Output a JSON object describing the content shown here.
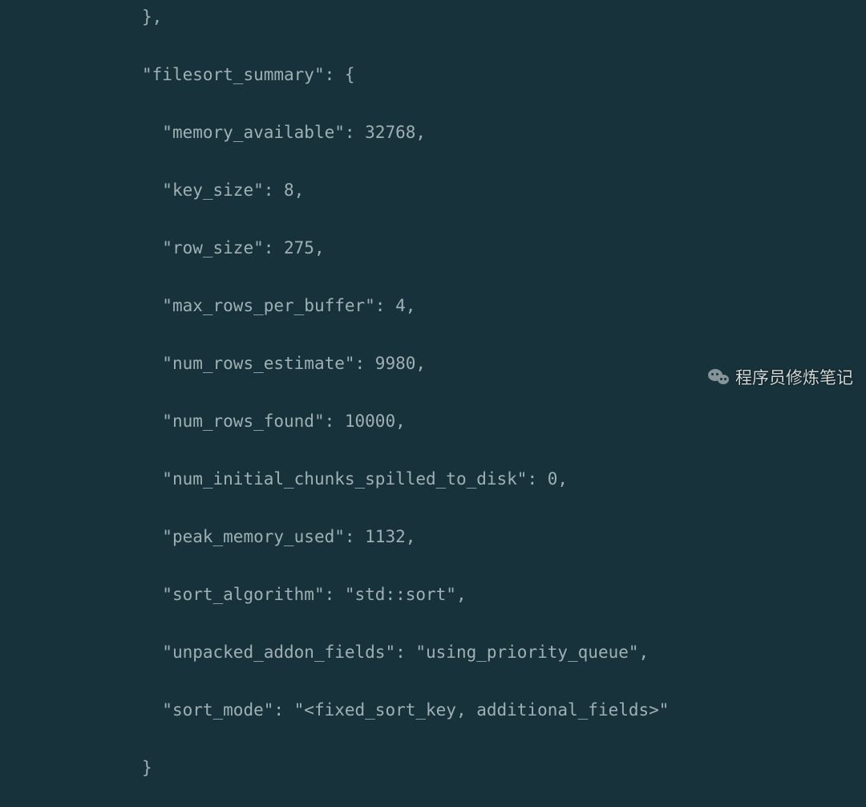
{
  "indent1": "              ",
  "indent2": "                ",
  "lines": {
    "l0": "},",
    "l1": "\"filesort_summary\": {",
    "l2": "\"memory_available\": 32768,",
    "l3": "\"key_size\": 8,",
    "l4": "\"row_size\": 275,",
    "l5": "\"max_rows_per_buffer\": 4,",
    "l6": "\"num_rows_estimate\": 9980,",
    "l7": "\"num_rows_found\": 10000,",
    "l8": "\"num_initial_chunks_spilled_to_disk\": 0,",
    "l9": "\"peak_memory_used\": 1132,",
    "l10": "\"sort_algorithm\": \"std::sort\",",
    "l11": "\"unpacked_addon_fields\": \"using_priority_queue\",",
    "l12": "\"sort_mode\": \"<fixed_sort_key, additional_fields>\"",
    "l13": "}"
  },
  "watermark": "程序员修炼笔记"
}
